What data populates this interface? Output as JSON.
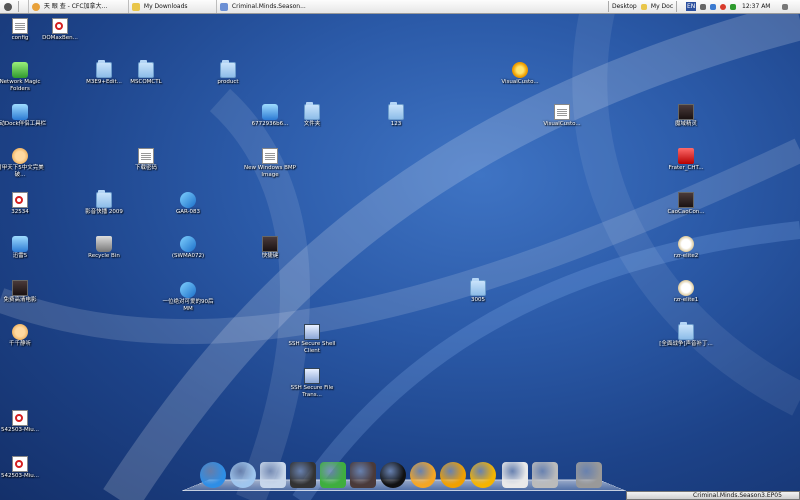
{
  "topbar": {
    "tasks": [
      {
        "label": "天 眼 查 - CFC加拿大..."
      },
      {
        "label": "My Downloads"
      },
      {
        "label": "Criminal.Minds.Season..."
      }
    ],
    "tray": {
      "desktop": "Desktop",
      "mydoc": "My Doc",
      "lang": "EN",
      "time": "12:37 AM"
    }
  },
  "desktop_icons": [
    {
      "label": "config",
      "type": "doc"
    },
    {
      "label": "DOMaxBen...",
      "type": "pdf"
    },
    {
      "label": "Network Magic Folders",
      "type": "green"
    },
    {
      "label": "M3E9+Edit...",
      "type": "folder"
    },
    {
      "label": "MSCOMCTL",
      "type": "folder"
    },
    {
      "label": "product",
      "type": "folder"
    },
    {
      "label": "VisualCusto...",
      "type": "gear"
    },
    {
      "label": "启动Dock伴侣工具栏",
      "type": "blueapp"
    },
    {
      "label": "6772936b6...",
      "type": "blueapp"
    },
    {
      "label": "文件夹",
      "type": "folder"
    },
    {
      "label": "123",
      "type": "folder"
    },
    {
      "label": "VisualCusto...",
      "type": "doc"
    },
    {
      "label": "魔域精灵",
      "type": "dark"
    },
    {
      "label": "冒甲天下5中文完美破...",
      "type": "face"
    },
    {
      "label": "下载密码",
      "type": "doc"
    },
    {
      "label": "New Windows BMP Image",
      "type": "doc"
    },
    {
      "label": "Frater_CHT...",
      "type": "red"
    },
    {
      "label": "32534",
      "type": "pdf"
    },
    {
      "label": "影音快播 2009",
      "type": "folder"
    },
    {
      "label": "GAR-083",
      "type": "bluex"
    },
    {
      "label": "CaoCaoCon...",
      "type": "dark"
    },
    {
      "label": "迅雷5",
      "type": "blueapp"
    },
    {
      "label": "Recycle Bin",
      "type": "bin"
    },
    {
      "label": "(SWMA072)",
      "type": "bluex"
    },
    {
      "label": "快捷键",
      "type": "dark"
    },
    {
      "label": "rzr-elite2",
      "type": "clock"
    },
    {
      "label": "免费高清电影",
      "type": "dark"
    },
    {
      "label": "3005",
      "type": "folder"
    },
    {
      "label": "rzr-elite1",
      "type": "clock"
    },
    {
      "label": "一位绝对可爱的90后MM",
      "type": "bluex"
    },
    {
      "label": "千千静听",
      "type": "face"
    },
    {
      "label": "SSH Secure Shell Client",
      "type": "shell"
    },
    {
      "label": "[全面战争]声音补丁...",
      "type": "folder"
    },
    {
      "label": "SSH Secure File Trans...",
      "type": "shell"
    },
    {
      "label": "542503-Miu...",
      "type": "pdf"
    },
    {
      "label": "542503-Miu...",
      "type": "pdf"
    }
  ],
  "dock": [
    {
      "icon": "internet-explorer-icon",
      "color": "#2e8ee6"
    },
    {
      "icon": "safari-compass-icon",
      "color": "#9fc6ee"
    },
    {
      "icon": "bird-app-icon",
      "color": "#c7d6ea"
    },
    {
      "icon": "clapperboard-icon",
      "color": "#333333"
    },
    {
      "icon": "messenger-people-icon",
      "color": "#3fae3f"
    },
    {
      "icon": "game-warrior-icon",
      "color": "#4a3a3a"
    },
    {
      "icon": "qq-penguin-icon",
      "color": "#111111"
    },
    {
      "icon": "media-player-icon",
      "color": "#f5a623"
    },
    {
      "icon": "gear-icon",
      "color": "#f0a000"
    },
    {
      "icon": "maxthon-m-icon",
      "color": "#f5b400"
    },
    {
      "icon": "word-document-icon",
      "color": "#e9e9e9"
    },
    {
      "icon": "system-preferences-icon",
      "color": "#bbbbbb"
    },
    {
      "icon": "trash-icon",
      "color": "#999999"
    }
  ],
  "window_strip": {
    "title": "Criminal.Minds.Season3.EP05"
  }
}
